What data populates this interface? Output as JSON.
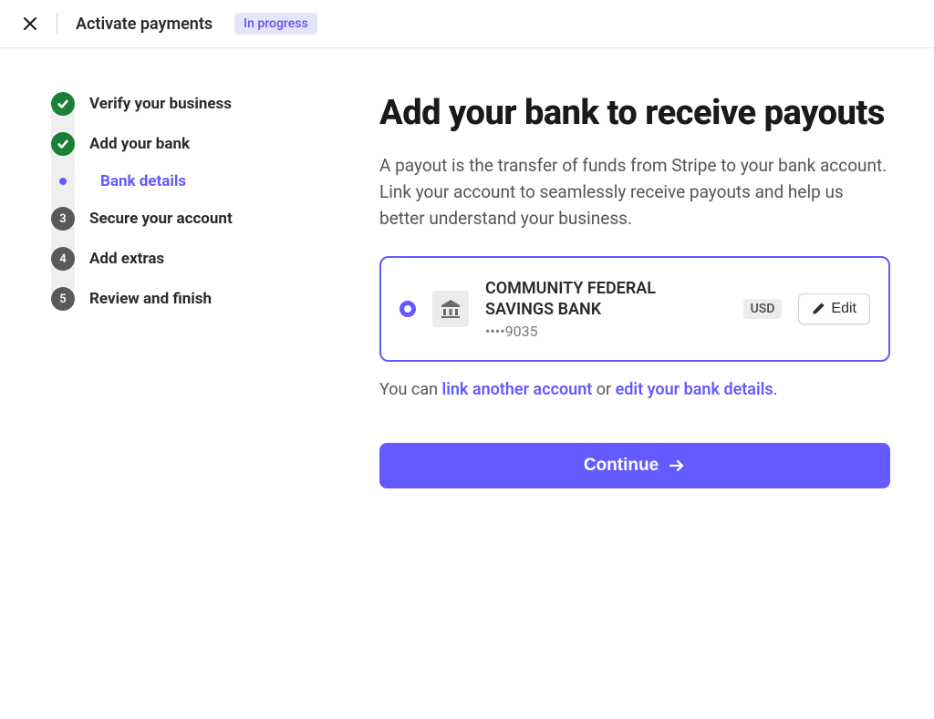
{
  "header": {
    "title": "Activate payments",
    "status_badge": "In progress"
  },
  "sidebar": {
    "steps": [
      {
        "label": "Verify your business",
        "state": "done"
      },
      {
        "label": "Add your bank",
        "state": "done"
      },
      {
        "label": "Secure your account",
        "state": "pending",
        "num": "3"
      },
      {
        "label": "Add extras",
        "state": "pending",
        "num": "4"
      },
      {
        "label": "Review and finish",
        "state": "pending",
        "num": "5"
      }
    ],
    "substep_label": "Bank details"
  },
  "main": {
    "heading": "Add your bank to receive payouts",
    "description": "A payout is the transfer of funds from Stripe to your bank account. Link your account to seamlessly receive payouts and help us better understand your business.",
    "bank": {
      "name": "COMMUNITY FEDERAL SAVINGS BANK",
      "account_masked": "••••9035",
      "currency": "USD",
      "edit_label": "Edit"
    },
    "hint_prefix": "You can ",
    "hint_link1": "link another account",
    "hint_middle": " or ",
    "hint_link2": "edit your bank details",
    "hint_suffix": ".",
    "continue_label": "Continue"
  }
}
